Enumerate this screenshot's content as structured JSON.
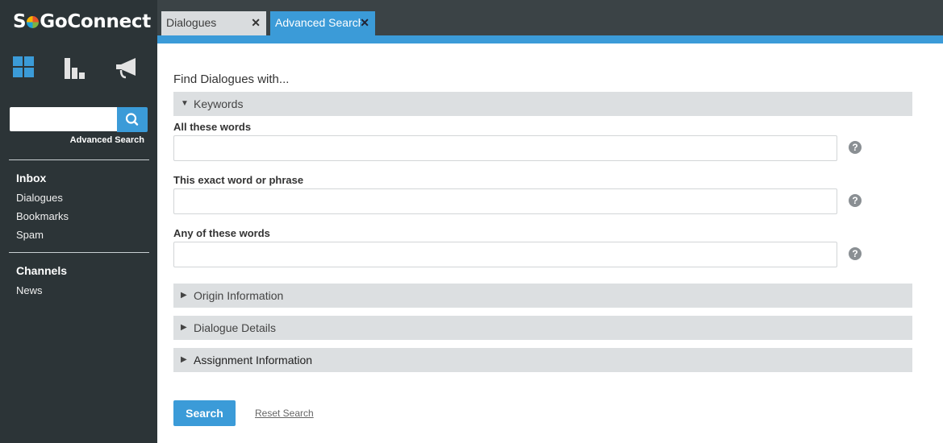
{
  "app": {
    "logo_prefix": "S",
    "logo_suffix": "GoConnect"
  },
  "sidebar": {
    "nav_icons": [
      "dashboard-grid-icon",
      "bar-chart-icon",
      "megaphone-icon"
    ],
    "search": {
      "value": "",
      "placeholder": ""
    },
    "advanced_search_link": "Advanced Search",
    "inbox_heading": "Inbox",
    "inbox_items": [
      "Dialogues",
      "Bookmarks",
      "Spam"
    ],
    "channels_heading": "Channels",
    "channel_items": [
      "News"
    ]
  },
  "tabs": [
    {
      "label": "Dialogues",
      "active": false
    },
    {
      "label": "Advanced Search",
      "active": true
    }
  ],
  "main": {
    "title": "Find Dialogues with...",
    "keywords_section": "Keywords",
    "fields": [
      {
        "label": "All these words",
        "value": ""
      },
      {
        "label": "This exact word or phrase",
        "value": ""
      },
      {
        "label": "Any of these words",
        "value": ""
      }
    ],
    "help_glyph": "?",
    "collapsed_sections": [
      "Origin Information",
      "Dialogue Details",
      "Assignment Information"
    ],
    "search_button": "Search",
    "reset_link": "Reset Search"
  },
  "colors": {
    "accent": "#3b9bd8",
    "sidebar_bg": "#2c3437",
    "topbar_bg": "#3b4346",
    "section_bg": "#dcdfe1"
  }
}
